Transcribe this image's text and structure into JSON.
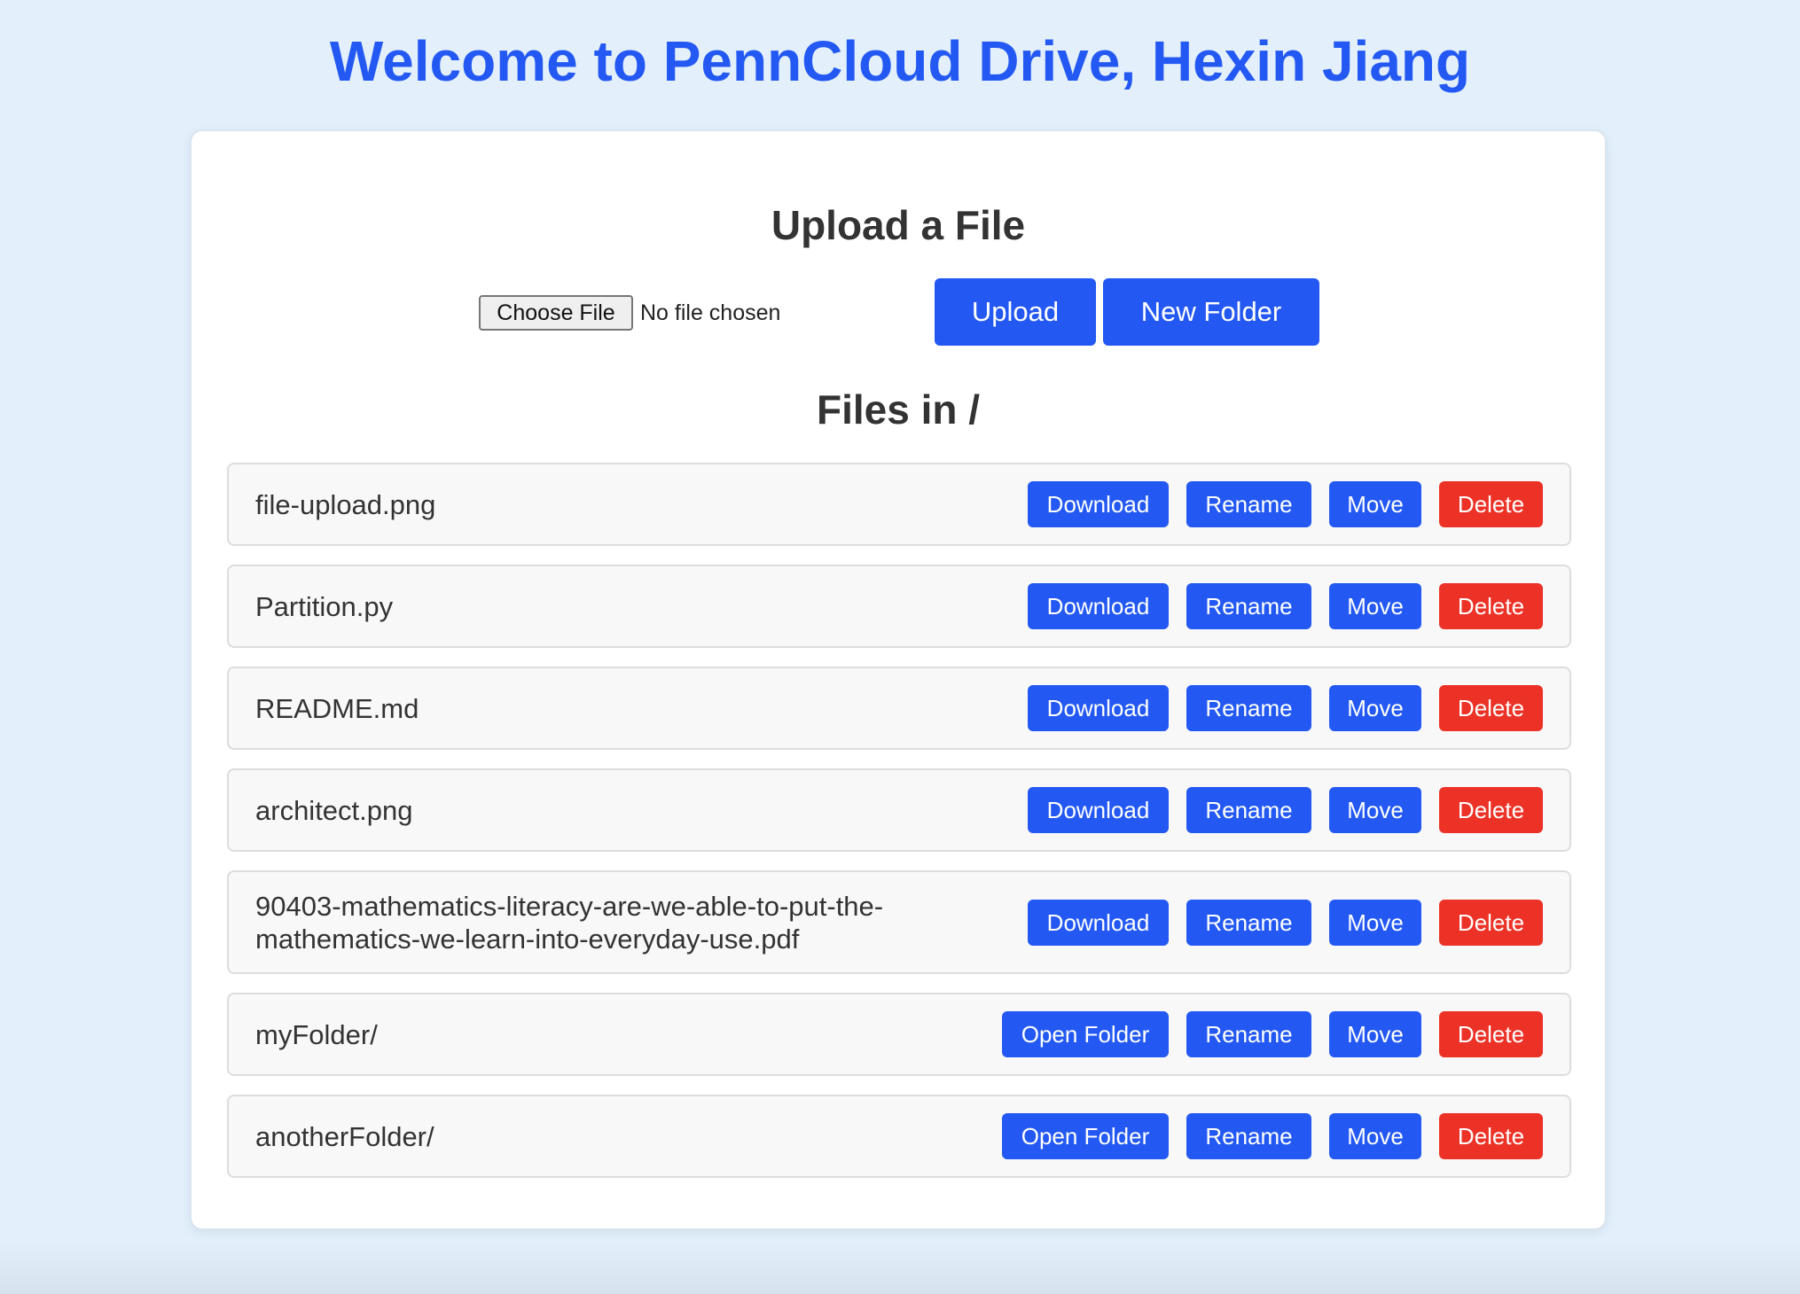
{
  "page_title": "Welcome to PennCloud Drive, Hexin Jiang",
  "upload": {
    "heading": "Upload a File",
    "choose_file_label": "Choose File",
    "file_status": "No file chosen",
    "upload_label": "Upload",
    "new_folder_label": "New Folder"
  },
  "files": {
    "heading": "Files in /",
    "actions": {
      "download": "Download",
      "open_folder": "Open Folder",
      "rename": "Rename",
      "move": "Move",
      "delete": "Delete"
    },
    "items": [
      {
        "name": "file-upload.png",
        "type": "file"
      },
      {
        "name": "Partition.py",
        "type": "file"
      },
      {
        "name": "README.md",
        "type": "file"
      },
      {
        "name": "architect.png",
        "type": "file"
      },
      {
        "name": "90403-mathematics-literacy-are-we-able-to-put-the-mathematics-we-learn-into-everyday-use.pdf",
        "type": "file"
      },
      {
        "name": "myFolder/",
        "type": "folder"
      },
      {
        "name": "anotherFolder/",
        "type": "folder"
      }
    ]
  },
  "colors": {
    "background": "#e3f0fb",
    "primary": "#2359f2",
    "danger": "#ec3226"
  }
}
